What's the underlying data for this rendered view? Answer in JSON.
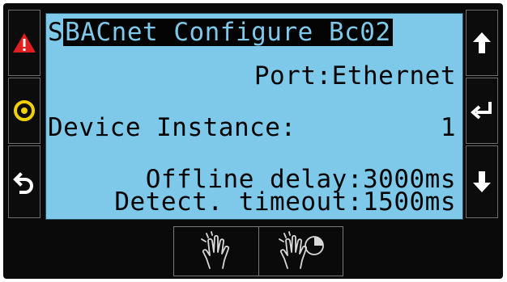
{
  "screen": {
    "title_indicator": "S",
    "title": "BACnet Configure Bc02",
    "port_line": "Port:Ethernet",
    "device_instance": {
      "label": "Device Instance:",
      "value": "1"
    },
    "offline_delay_line": "Offline delay:3000ms",
    "detect_timeout_line": "Detect. timeout:1500ms"
  },
  "left_buttons": [
    "alarm-triangle-icon",
    "program-circle-icon",
    "back-arrow-icon"
  ],
  "right_buttons": [
    "up-arrow-icon",
    "enter-icon",
    "down-arrow-icon"
  ],
  "bottom_buttons": [
    "single-tap-gesture-icon",
    "tap-hold-gesture-icon"
  ],
  "colors": {
    "screen_background": "#7ec8e9",
    "alarm": "#e02020",
    "program": "#f0d000",
    "bezel": "#0a0a0a"
  }
}
